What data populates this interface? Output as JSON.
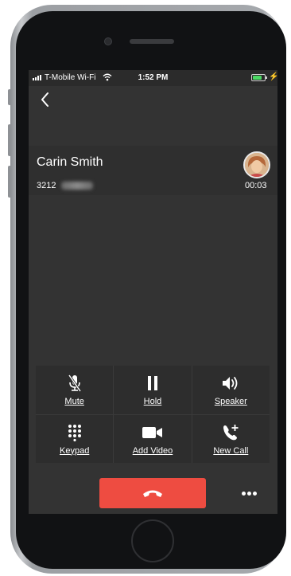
{
  "status_bar": {
    "carrier": "T-Mobile Wi-Fi",
    "time": "1:52 PM",
    "charging_symbol": "⚡"
  },
  "call": {
    "caller_name": "Carin Smith",
    "number_visible": "3212",
    "duration": "00:03"
  },
  "controls": [
    {
      "label": "Mute",
      "icon": "mic-muted-icon"
    },
    {
      "label": "Hold",
      "icon": "pause-icon"
    },
    {
      "label": "Speaker",
      "icon": "speaker-icon"
    },
    {
      "label": "Keypad",
      "icon": "keypad-icon"
    },
    {
      "label": "Add Video",
      "icon": "video-camera-icon"
    },
    {
      "label": "New Call",
      "icon": "phone-add-icon"
    }
  ],
  "colors": {
    "screen_bg": "#333333",
    "end_call": "#ee4c41",
    "battery": "#4cd964"
  }
}
